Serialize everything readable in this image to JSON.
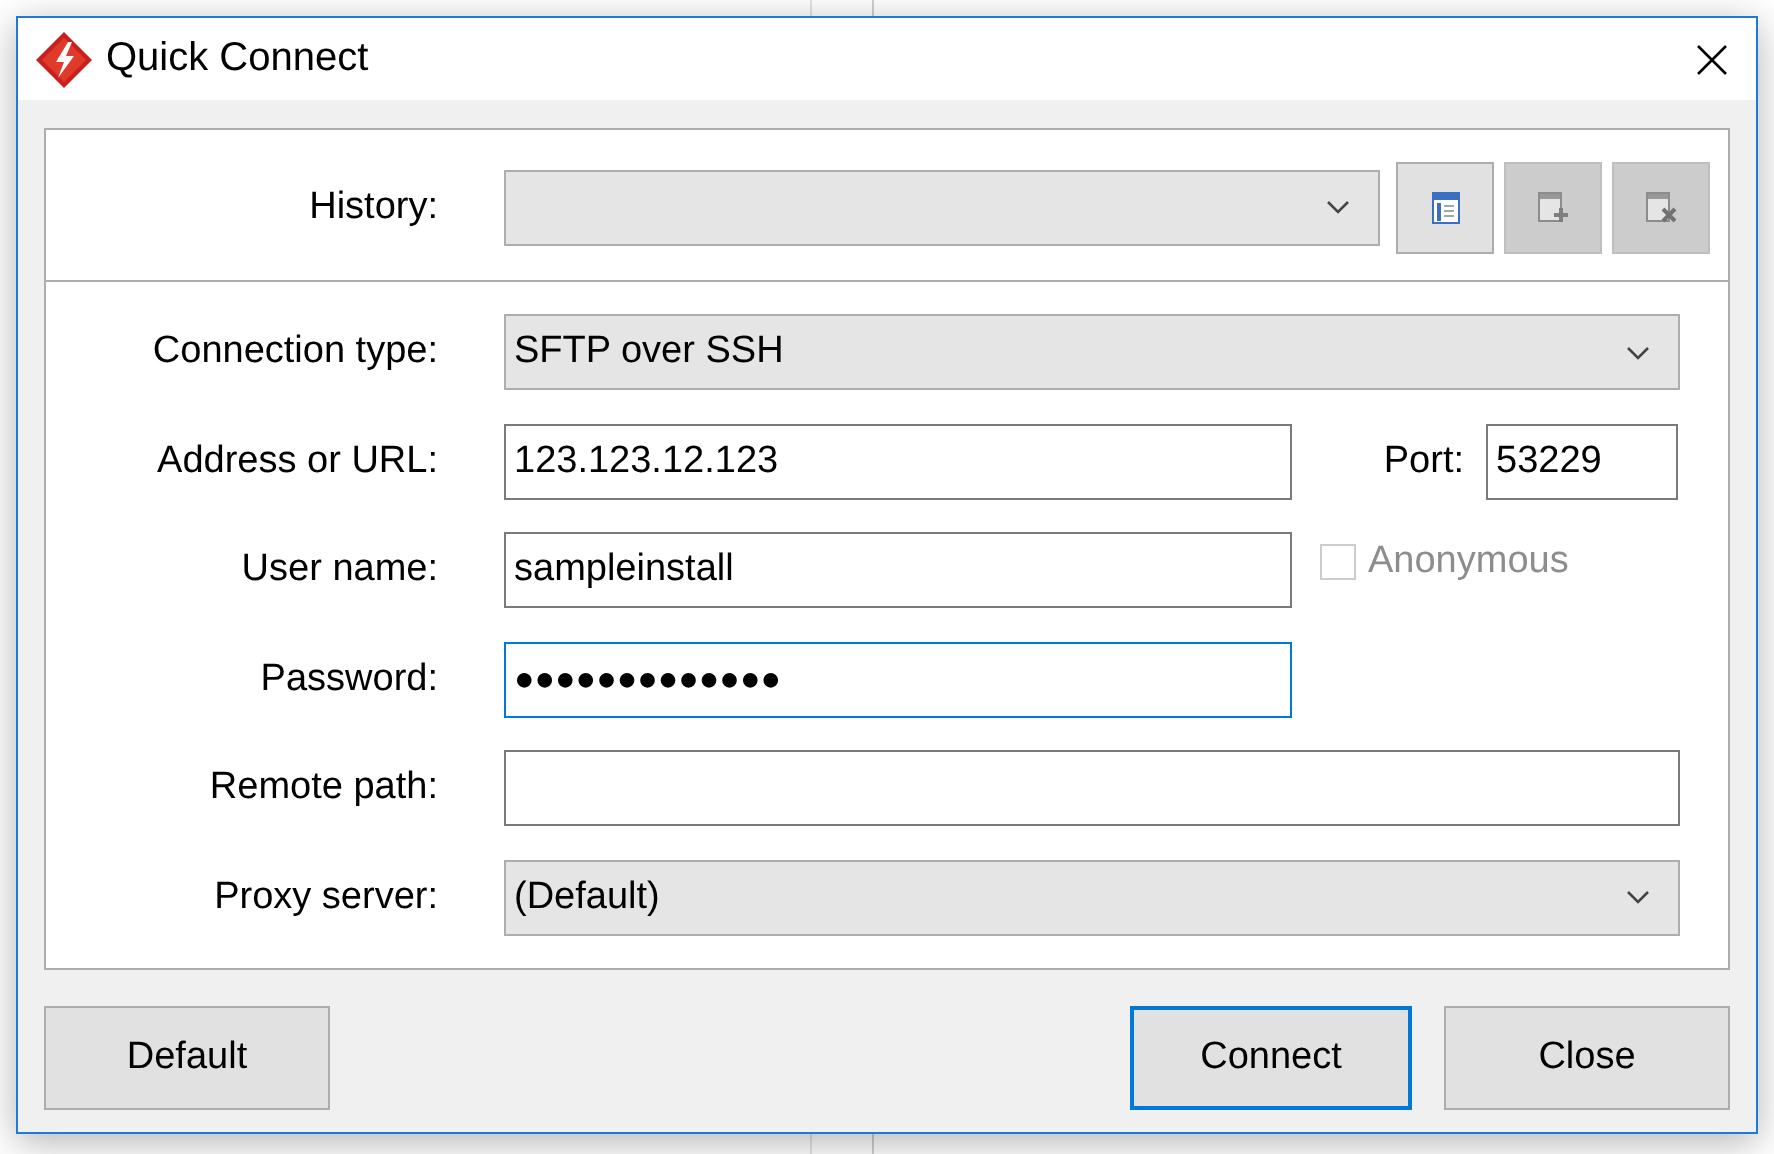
{
  "window": {
    "title": "Quick Connect"
  },
  "history": {
    "label": "History:",
    "buttons": [
      {
        "kind": "open",
        "disabled": false
      },
      {
        "kind": "add",
        "disabled": true
      },
      {
        "kind": "delete",
        "disabled": true
      }
    ]
  },
  "fields": [
    {
      "kind": "dropdown",
      "label": "Connection type:",
      "value": "SFTP over SSH"
    },
    {
      "kind": "text",
      "label": "Address or URL:",
      "value": "123.123.12.123",
      "focused": false,
      "side": {
        "kind": "port",
        "label": "Port:",
        "value": "53229"
      }
    },
    {
      "kind": "text",
      "label": "User name:",
      "value": "sampleinstall",
      "focused": false,
      "side": {
        "kind": "checkbox",
        "label": "Anonymous",
        "checked": false,
        "disabled": true
      }
    },
    {
      "kind": "password",
      "label": "Password:",
      "value": "●●●●●●●●●●●●●",
      "focused": true
    },
    {
      "kind": "text",
      "label": "Remote path:",
      "focused": false
    },
    {
      "kind": "dropdown",
      "label": "Proxy server:",
      "value": "(Default)"
    }
  ],
  "buttons": [
    {
      "label": "Default",
      "default": false
    },
    {
      "label": "Connect",
      "default": true
    },
    {
      "label": "Close",
      "default": false
    }
  ]
}
